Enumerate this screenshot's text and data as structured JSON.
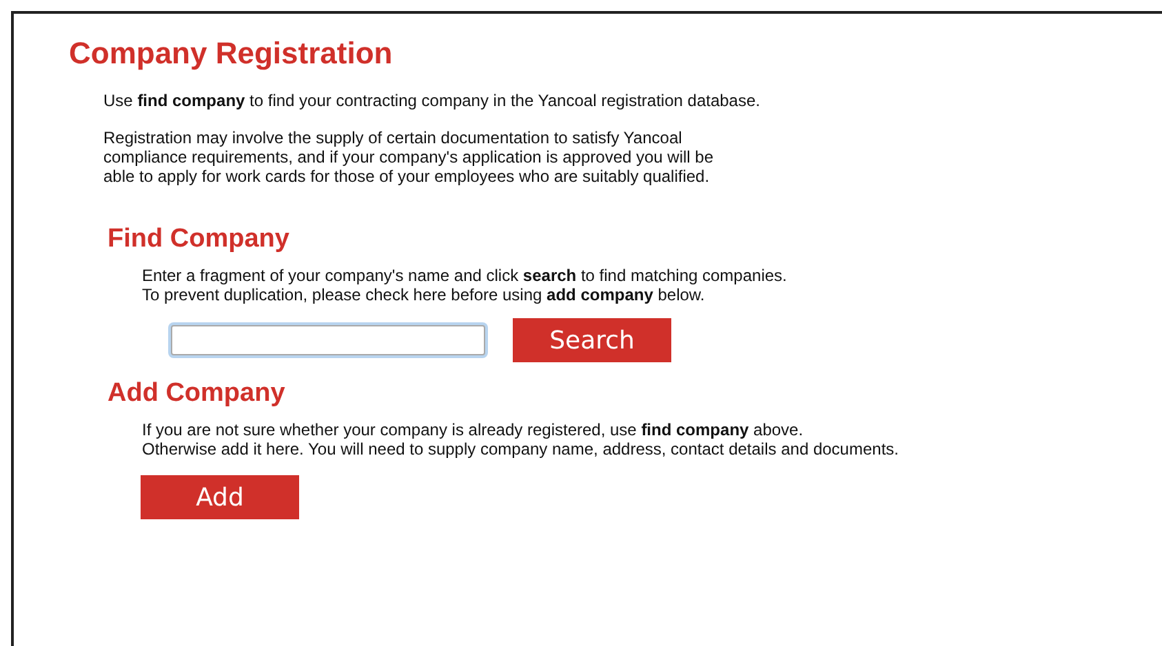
{
  "title": "Company Registration",
  "intro": [
    [
      "Use **find company** to find your contracting company in the Yancoal registration database."
    ],
    [
      "Registration may involve the supply of certain documentation to satisfy Yancoal",
      "compliance requirements, and if your company's application is approved you will be",
      "able to apply for work cards for those of your employees who are suitably qualified."
    ]
  ],
  "sections": [
    {
      "kind": "search",
      "heading": "Find Company",
      "lines": [
        "Enter a fragment of your company's name and click **search** to find matching companies.",
        "To prevent duplication, please check here before using **add company** below."
      ],
      "button": "Search"
    },
    {
      "kind": "add",
      "heading": "Add Company",
      "lines": [
        "If you are not sure whether your company is already registered, use **find company** above.",
        "Otherwise add it here. You will need to supply company name, address, contact details and documents."
      ],
      "button": "Add"
    }
  ]
}
